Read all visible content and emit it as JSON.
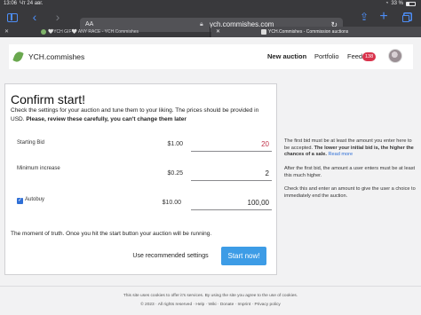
{
  "status_bar": {
    "time": "13:06",
    "date": "Чт 24 авг.",
    "battery": "33 %"
  },
  "browser": {
    "address_prefix": "AA",
    "url": "ych.commishes.com",
    "tabs": [
      {
        "title": "🤍YCH GIF🤍 ANY RACE - YCH.Commishes"
      },
      {
        "title": "YCH.Commishes - Commission auctions"
      }
    ]
  },
  "header": {
    "logo_text": "YCH.commishes",
    "nav": {
      "new_auction": "New auction",
      "portfolio": "Portfolio",
      "feed": "Feed",
      "feed_count": "138"
    }
  },
  "confirm": {
    "title": "Confirm start!",
    "intro_plain": "Check the settings for your auction and tune them to your liking. The prices should be provided in USD. ",
    "intro_bold": "Please, review these carefully, you can't change them later",
    "starting_bid": {
      "label": "Starting Bid",
      "prefix": "$1.00",
      "value": "20"
    },
    "minimum_increase": {
      "label": "Minimum increase",
      "prefix": "$0.25",
      "value": "2"
    },
    "autobuy": {
      "label": "Autobuy",
      "checkbox": "✓",
      "prefix": "$10.00",
      "value": "100,00"
    },
    "moment_text": "The moment of truth. Once you hit the start button your auction will be running.",
    "use_recommended": "Use recommended settings",
    "start_now": "Start now!"
  },
  "help": {
    "p1_plain": "The first bid must be at least the amount you enter here to be accepted. ",
    "p1_bold": "The lower your initial bid is, the higher the chances of a sale.",
    "p1_link": "Read more",
    "p2": "After the first bid, the amount a user enters must be at least this much higher.",
    "p3": "Check this and enter an amount to give the user a choice to immediately end the auction."
  },
  "footer": {
    "line1": "This site uses cookies to offer it's services. By using the site you agree to the use of cookies.",
    "line2": "© 2023 · All rights reserved · Help · Wiki · Donate · Imprint · Privacy policy"
  }
}
